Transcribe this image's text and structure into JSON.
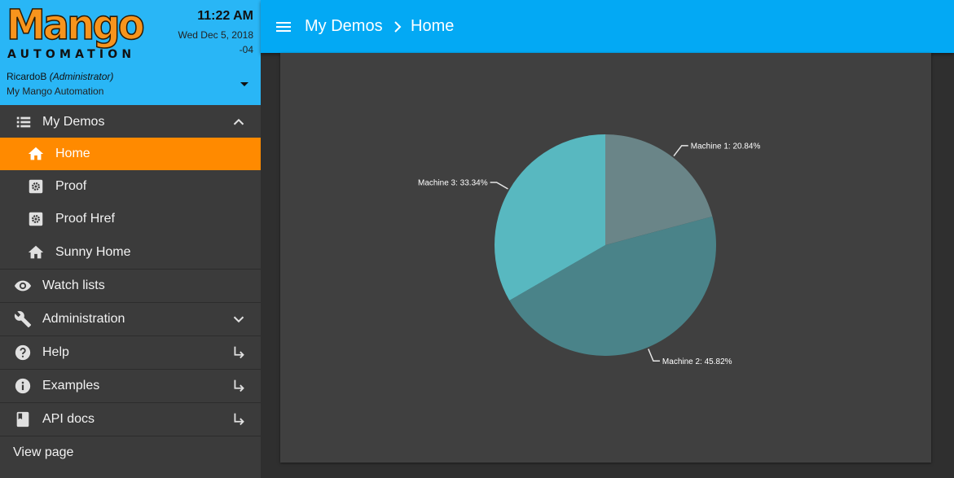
{
  "brand": {
    "logo_text": "Mango",
    "logo_subtext": "AUTOMATION"
  },
  "clock": {
    "time": "11:22 AM",
    "date": "Wed Dec 5, 2018",
    "tz": "-04"
  },
  "user": {
    "name": "RicardoB",
    "role": "(Administrator)",
    "site": "My Mango Automation"
  },
  "sidebar": {
    "items": [
      {
        "label": "My Demos",
        "icon": "list-icon"
      },
      {
        "label": "Home",
        "icon": "home-icon"
      },
      {
        "label": "Proof",
        "icon": "settings-box-icon"
      },
      {
        "label": "Proof Href",
        "icon": "settings-box-icon"
      },
      {
        "label": "Sunny Home",
        "icon": "home-icon"
      },
      {
        "label": "Watch lists",
        "icon": "eye-icon"
      },
      {
        "label": "Administration",
        "icon": "wrench-icon"
      },
      {
        "label": "Help",
        "icon": "help-circle-icon"
      },
      {
        "label": "Examples",
        "icon": "info-icon"
      },
      {
        "label": "API docs",
        "icon": "book-icon"
      },
      {
        "label": "View page"
      }
    ]
  },
  "breadcrumb": {
    "parent": "My Demos",
    "current": "Home"
  },
  "colors": {
    "accent": "#ff8a00",
    "header": "#29b6f6",
    "topbar": "#03a9f4",
    "slice1": "#6a8588",
    "slice2": "#4a8389",
    "slice3": "#58b8c0"
  },
  "chart_data": {
    "type": "pie",
    "categories": [
      "Machine 1",
      "Machine 2",
      "Machine 3"
    ],
    "values": [
      20.84,
      45.82,
      33.34
    ],
    "labels": [
      "Machine 1: 20.84%",
      "Machine 2: 45.82%",
      "Machine 3: 33.34%"
    ],
    "colors": [
      "#6a8588",
      "#4a8389",
      "#58b8c0"
    ]
  }
}
